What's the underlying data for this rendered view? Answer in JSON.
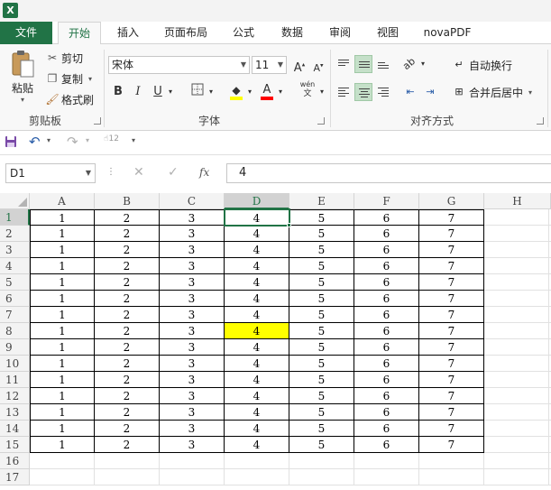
{
  "app": {
    "logo_letter": "X"
  },
  "tabs": {
    "file": "文件",
    "items": [
      "开始",
      "插入",
      "页面布局",
      "公式",
      "数据",
      "审阅",
      "视图",
      "novaPDF"
    ],
    "active_index": 0
  },
  "clipboard": {
    "paste": "粘贴",
    "cut": "剪切",
    "copy": "复制",
    "format_painter": "格式刷",
    "group_label": "剪贴板"
  },
  "font": {
    "name": "宋体",
    "size": "11",
    "bold": "B",
    "italic": "I",
    "underline": "U",
    "highlight_color": "#ffff00",
    "font_color": "#ff0000",
    "phonetic": "wén",
    "group_label": "字体"
  },
  "alignment": {
    "wrap_text": "自动换行",
    "merge_center": "合并后居中",
    "group_label": "对齐方式"
  },
  "qat": {
    "touch_label": "12"
  },
  "formula_bar": {
    "name_box": "D1",
    "fx": "fx",
    "value": "4"
  },
  "sheet": {
    "columns": [
      "A",
      "B",
      "C",
      "D",
      "E",
      "F",
      "G",
      "H"
    ],
    "selected_column": "D",
    "row_numbers": [
      "1",
      "2",
      "3",
      "4",
      "5",
      "6",
      "7",
      "8",
      "9",
      "10",
      "11",
      "12",
      "13",
      "14",
      "15",
      "16",
      "17"
    ],
    "row_values": [
      "1",
      "2",
      "3",
      "4",
      "5",
      "6",
      "7"
    ],
    "filled_row_count": 15,
    "selected_cell": "D1",
    "highlight_cell": "D8",
    "highlight_color": "#ffff00",
    "accent_color": "#217346"
  }
}
